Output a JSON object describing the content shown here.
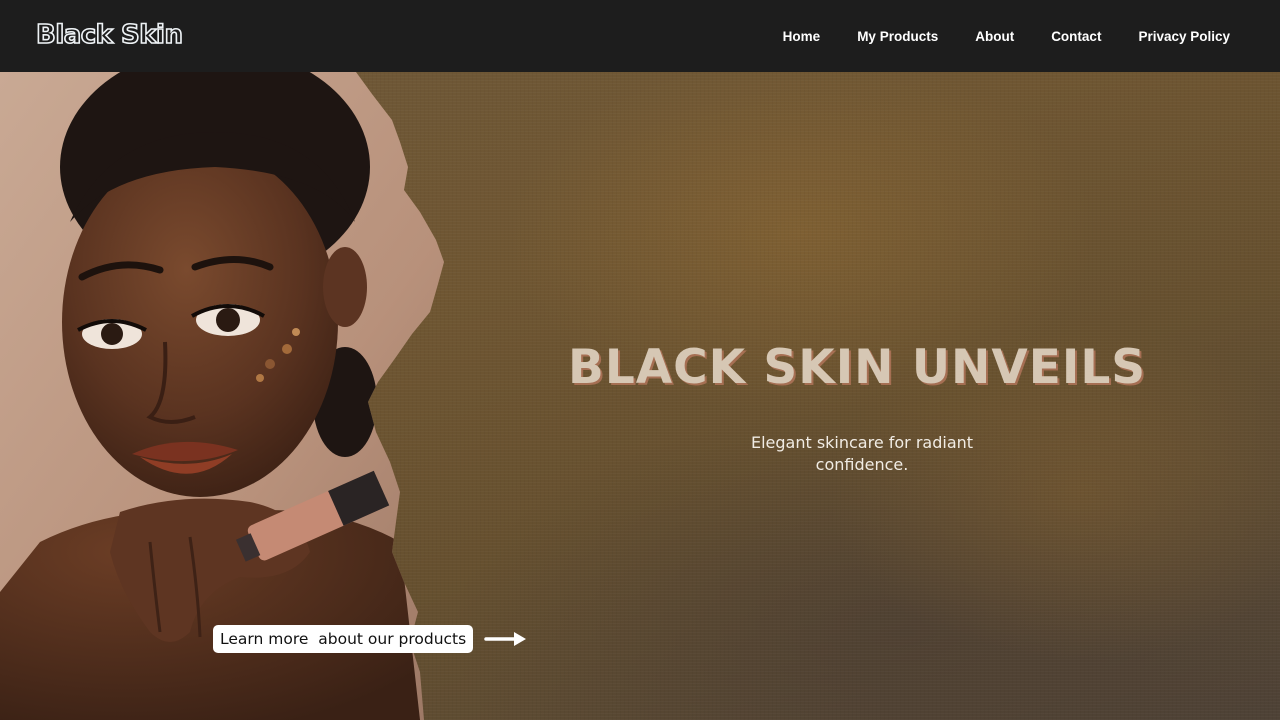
{
  "header": {
    "brand": "Black Skin",
    "nav": [
      {
        "label": "Home"
      },
      {
        "label": "My Products"
      },
      {
        "label": "About"
      },
      {
        "label": "Contact"
      },
      {
        "label": "Privacy Policy"
      }
    ]
  },
  "hero": {
    "headline": "BLACK SKIN UNVEILS",
    "subtitle": "Elegant skincare for radiant confidence.",
    "cta_label": "Learn more  about our products",
    "arrow_icon": "arrow-right-icon"
  },
  "colors": {
    "navbar_bg": "#1d1d1d",
    "hero_bg": "#6e5838",
    "headline": "#d6c7b4",
    "headline_shadow": "#b9785f"
  }
}
